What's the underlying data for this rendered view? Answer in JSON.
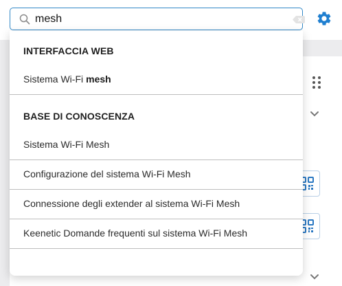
{
  "search": {
    "value": "mesh",
    "placeholder": ""
  },
  "icons": {
    "search": "search-icon",
    "clear": "clear-icon",
    "settings": "gear-icon",
    "drag": "drag-handle-icon",
    "expand": "chevron-down-icon",
    "qr": "qr-code-icon"
  },
  "colors": {
    "accent": "#2f86c6",
    "gear": "#1f7fd0",
    "qr": "#2a78c2"
  },
  "dropdown": {
    "web_section": {
      "heading": "INTERFACCIA WEB",
      "items": [
        {
          "prefix": "Sistema Wi-Fi",
          "match": "mesh"
        }
      ]
    },
    "kb_section": {
      "heading": "BASE DI CONOSCENZA",
      "items": [
        {
          "label": "Sistema Wi-Fi Mesh"
        },
        {
          "label": "Configurazione del sistema Wi-Fi Mesh"
        },
        {
          "label": "Connessione degli extender al sistema Wi-Fi Mesh"
        },
        {
          "label": "Keenetic Domande frequenti sul sistema Wi-Fi Mesh"
        }
      ]
    }
  }
}
